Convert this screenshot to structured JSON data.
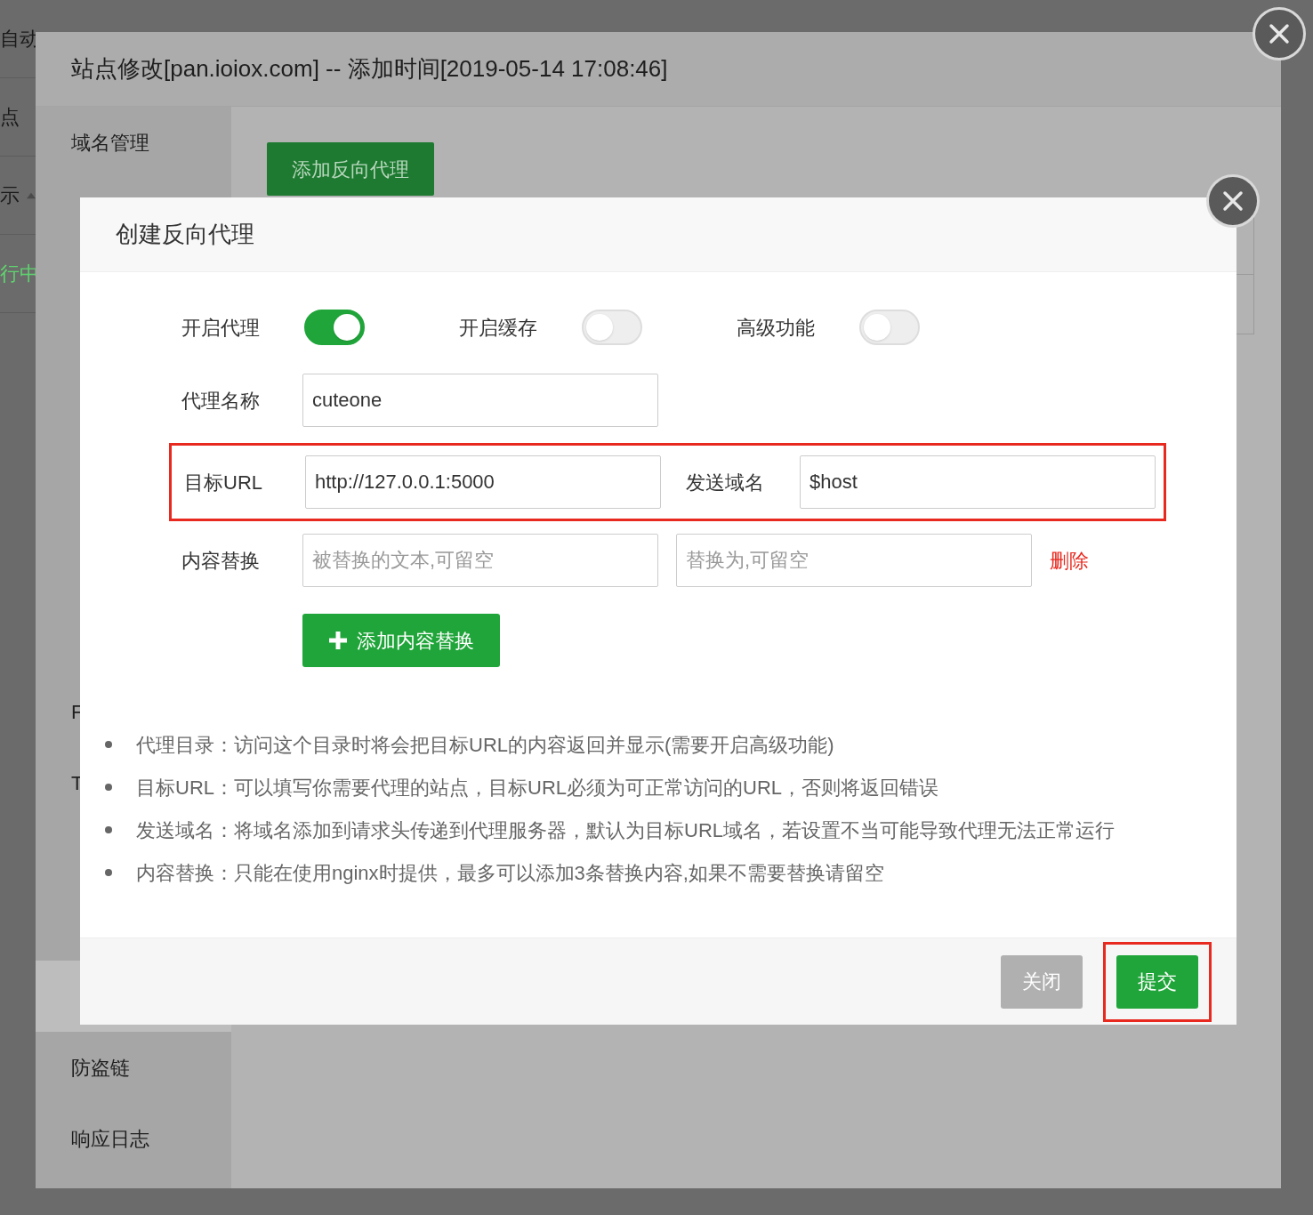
{
  "background_page": {
    "items": [
      {
        "text": "自动",
        "kind": "plain"
      },
      {
        "text": "点",
        "kind": "plain"
      },
      {
        "text": "示",
        "kind": "sort"
      },
      {
        "text": "行中",
        "kind": "status"
      }
    ]
  },
  "site_dialog": {
    "title": "站点修改[pan.ioiox.com] -- 添加时间[2019-05-14 17:08:46]",
    "sidebar": [
      {
        "label": "域名管理",
        "selected": false
      },
      {
        "label": "F",
        "selected": false
      },
      {
        "label": "T",
        "selected": false
      },
      {
        "label": "防盗链",
        "selected": false
      },
      {
        "label": "响应日志",
        "selected": false
      }
    ],
    "add_button": "添加反向代理"
  },
  "proxy_dialog": {
    "title": "创建反向代理",
    "toggles": [
      {
        "label": "开启代理",
        "on": true
      },
      {
        "label": "开启缓存",
        "on": false
      },
      {
        "label": "高级功能",
        "on": false
      }
    ],
    "name_field": {
      "label": "代理名称",
      "value": "cuteone"
    },
    "target_row": {
      "highlighted": true,
      "label": "目标URL",
      "value": "http://127.0.0.1:5000",
      "host_label": "发送域名",
      "host_value": "$host"
    },
    "replace_row": {
      "label": "内容替换",
      "from_placeholder": "被替换的文本,可留空",
      "to_placeholder": "替换为,可留空",
      "delete": "删除"
    },
    "add_replace_button": "添加内容替换",
    "tips": [
      "代理目录：访问这个目录时将会把目标URL的内容返回并显示(需要开启高级功能)",
      "目标URL：可以填写你需要代理的站点，目标URL必须为可正常访问的URL，否则将返回错误",
      "发送域名：将域名添加到请求头传递到代理服务器，默认为目标URL域名，若设置不当可能导致代理无法正常运行",
      "内容替换：只能在使用nginx时提供，最多可以添加3条替换内容,如果不需要替换请留空"
    ],
    "buttons": [
      {
        "label": "关闭",
        "kind": "secondary",
        "highlighted": false
      },
      {
        "label": "提交",
        "kind": "primary",
        "highlighted": true
      }
    ]
  }
}
